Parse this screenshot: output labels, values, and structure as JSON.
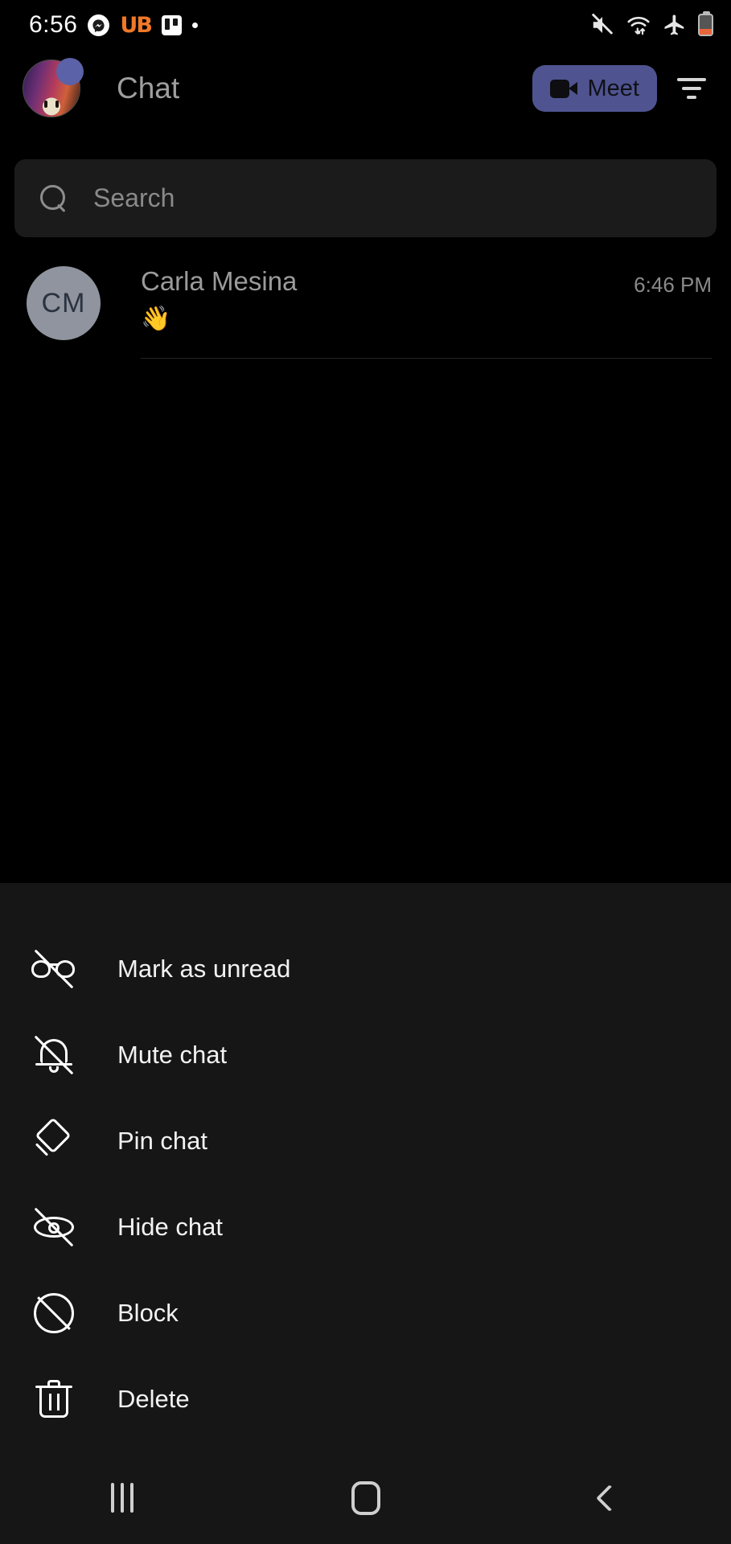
{
  "status_bar": {
    "time": "6:56",
    "left_icons": [
      "messenger-icon",
      "ub-app-icon",
      "trello-icon",
      "dot-icon"
    ],
    "ub_label": "UB",
    "right_icons": [
      "mute-icon",
      "wifi-icon",
      "airplane-mode-icon",
      "battery-icon"
    ],
    "battery_color": "#e8663a"
  },
  "header": {
    "title": "Chat",
    "avatar_name": "profile-avatar",
    "meet_button_label": "Meet",
    "meet_button_color": "#4f5490",
    "filter_icon": "filter-icon"
  },
  "search": {
    "placeholder": "Search",
    "icon": "search-icon"
  },
  "chat_list": [
    {
      "initials": "CM",
      "name": "Carla Mesina",
      "time": "6:46 PM",
      "snippet": "👋"
    }
  ],
  "context_menu": {
    "items": [
      {
        "label": "Mark as unread",
        "icon": "glasses-off-icon"
      },
      {
        "label": "Mute chat",
        "icon": "bell-off-icon"
      },
      {
        "label": "Pin chat",
        "icon": "pin-icon"
      },
      {
        "label": "Hide chat",
        "icon": "eye-off-icon"
      },
      {
        "label": "Block",
        "icon": "block-icon"
      },
      {
        "label": "Delete",
        "icon": "trash-icon"
      }
    ]
  },
  "nav_bar": {
    "recents_label": "recents-button",
    "home_label": "home-button",
    "back_label": "back-button"
  }
}
